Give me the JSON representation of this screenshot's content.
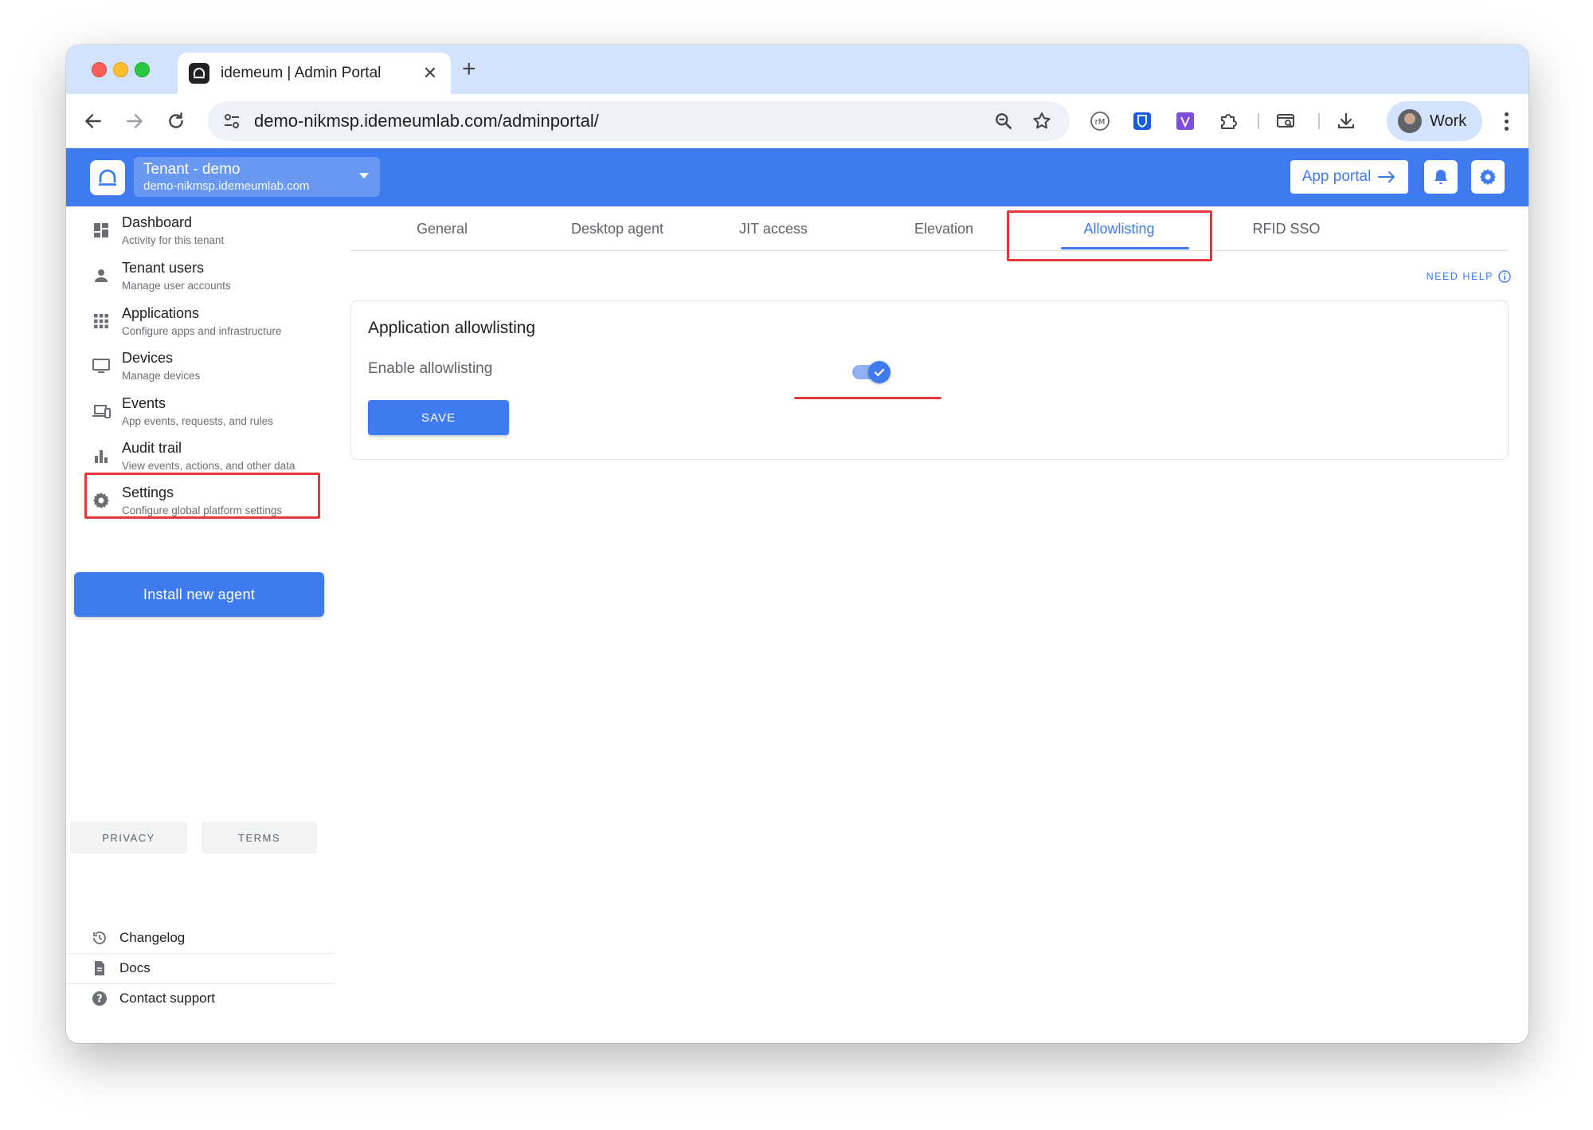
{
  "browser": {
    "tab_title": "idemeum | Admin Portal",
    "close_glyph": "✕",
    "new_tab_glyph": "+",
    "url": "demo-nikmsp.idemeumlab.com/adminportal/",
    "profile_name": "Work"
  },
  "header": {
    "tenant_name": "Tenant - demo",
    "tenant_domain": "demo-nikmsp.idemeumlab.com",
    "app_portal_label": "App portal",
    "brand_color": "#3f7bf0"
  },
  "sidebar": {
    "items": [
      {
        "label": "Dashboard",
        "sub": "Activity for this tenant",
        "icon": "dashboard-icon"
      },
      {
        "label": "Tenant users",
        "sub": "Manage user accounts",
        "icon": "person-icon"
      },
      {
        "label": "Applications",
        "sub": "Configure apps and infrastructure",
        "icon": "apps-grid-icon"
      },
      {
        "label": "Devices",
        "sub": "Manage devices",
        "icon": "monitor-icon"
      },
      {
        "label": "Events",
        "sub": "App events, requests, and rules",
        "icon": "devices-icon"
      },
      {
        "label": "Audit trail",
        "sub": "View events, actions, and other data",
        "icon": "bar-chart-icon"
      },
      {
        "label": "Settings",
        "sub": "Configure global platform settings",
        "icon": "gear-icon"
      }
    ],
    "install_label": "Install new agent",
    "footer": [
      {
        "label": "Changelog",
        "icon": "history-icon"
      },
      {
        "label": "Docs",
        "icon": "document-icon"
      },
      {
        "label": "Contact support",
        "icon": "help-icon"
      }
    ],
    "privacy_label": "PRIVACY",
    "terms_label": "TERMS"
  },
  "main": {
    "tabs": [
      {
        "label": "General"
      },
      {
        "label": "Desktop agent"
      },
      {
        "label": "JIT access"
      },
      {
        "label": "Elevation"
      },
      {
        "label": "Allowlisting",
        "active": true
      },
      {
        "label": "RFID SSO"
      }
    ],
    "need_help_label": "NEED HELP",
    "card_title": "Application allowlisting",
    "setting_label": "Enable allowlisting",
    "toggle_enabled": true,
    "save_label": "SAVE"
  },
  "annotation_color": "#e5383b"
}
